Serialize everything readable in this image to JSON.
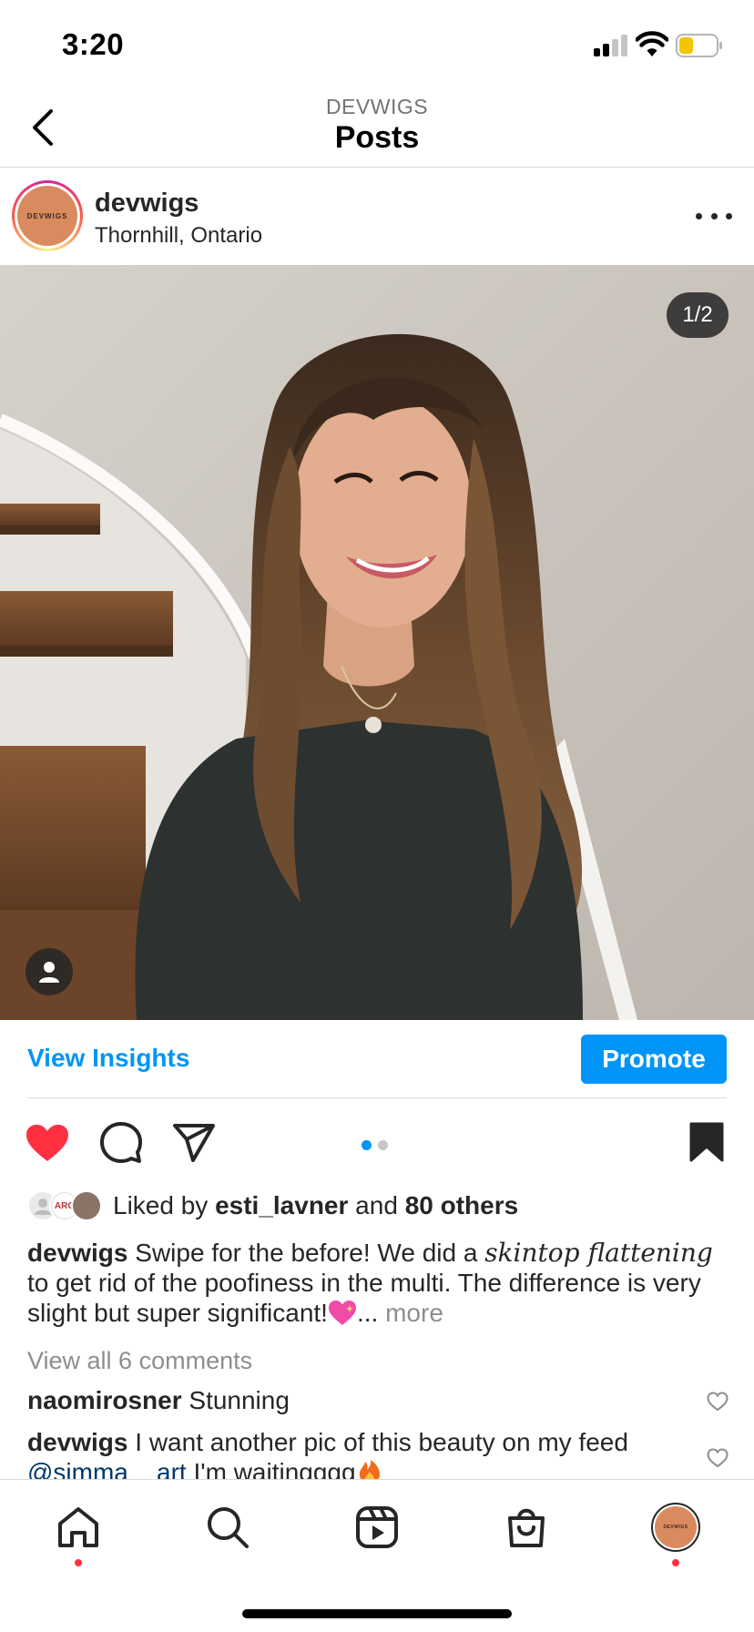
{
  "status_bar": {
    "time": "3:20"
  },
  "header": {
    "subtitle": "DEVWIGS",
    "title": "Posts"
  },
  "post": {
    "username": "devwigs",
    "location": "Thornhill, Ontario",
    "avatar_text": "DEVWIGS",
    "page_indicator": "1/2",
    "carousel_active_index": 0,
    "carousel_count": 2
  },
  "insights": {
    "view_label": "View Insights",
    "promote_label": "Promote"
  },
  "likes": {
    "prefix": "Liked by ",
    "user": "esti_lavner",
    "joiner": " and ",
    "others": "80 others",
    "avatar_text": "ARG"
  },
  "caption": {
    "username": "devwigs",
    "text_1": " Swipe for the before! We did a ",
    "styled": "skintop flattening",
    "text_2": " to get rid of the poofiness in the multi. The difference is very slight but super significant!",
    "ellipsis": "... ",
    "more": "more"
  },
  "comments_link": "View all 6 comments",
  "comments": [
    {
      "username": "naomirosner",
      "text": " Stunning"
    },
    {
      "username": "devwigs",
      "text": " I want another pic of this beauty on my feed ",
      "mention": "@simma__art",
      "text_2": " I'm waitingggg"
    }
  ],
  "colors": {
    "accent": "#0095f6",
    "like": "#ff3040",
    "text": "#262626",
    "muted": "#8e8e8e"
  },
  "icons": [
    "back-icon",
    "more-icon",
    "heart-icon",
    "comment-icon",
    "share-icon",
    "bookmark-icon",
    "home-icon",
    "search-icon",
    "reels-icon",
    "shop-icon"
  ]
}
